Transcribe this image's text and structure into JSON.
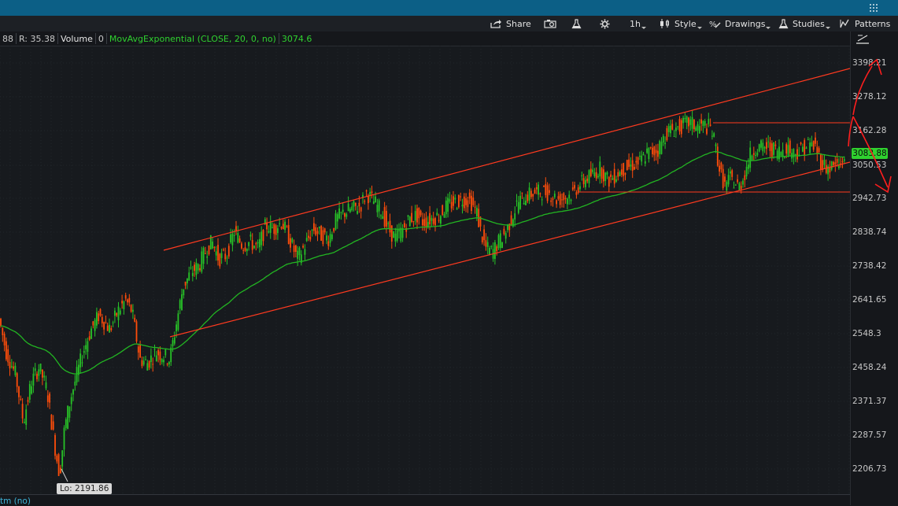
{
  "toolbar": {
    "share_label": "Share",
    "timeframe_label": "1h",
    "style_label": "Style",
    "drawings_label": "Drawings",
    "studies_label": "Studies",
    "patterns_label": "Patterns"
  },
  "study_bar": {
    "truncated_value": "88",
    "r_label": "R: 35.38",
    "volume_label": "Volume",
    "volume_value": "0",
    "ma_label": "MovAvgExponential (CLOSE, 20, 0, no)",
    "ma_value": "3074.6"
  },
  "lower_study_label": "tm (no)",
  "colors": {
    "up_candle": "#27c227",
    "down_candle": "#ff4d0a",
    "ema_line": "#22b522",
    "trendline": "#ff3a1f",
    "annotation": "#ff1e1e",
    "last_price_bg": "#2fd12f"
  },
  "chart_data": {
    "type": "candlestick",
    "instrument_timeframe": "1h",
    "y_ticks": [
      "3398.21",
      "3278.12",
      "3162.28",
      "3050.53",
      "2942.73",
      "2838.74",
      "2738.42",
      "2641.65",
      "2548.3",
      "2458.24",
      "2371.37",
      "2287.57",
      "2206.73"
    ],
    "ylim": [
      2170,
      3470
    ],
    "y_scale": "log",
    "last_price": "3083.88",
    "low_label": "Lo: 2191.86",
    "low_value": 2191.86,
    "ema_period": 20,
    "ema_last_value": 3074.6,
    "price_path": [
      [
        0,
        2600
      ],
      [
        10,
        2500
      ],
      [
        22,
        2440
      ],
      [
        32,
        2320
      ],
      [
        42,
        2420
      ],
      [
        52,
        2460
      ],
      [
        62,
        2400
      ],
      [
        72,
        2260
      ],
      [
        78,
        2192
      ],
      [
        84,
        2300
      ],
      [
        92,
        2380
      ],
      [
        100,
        2440
      ],
      [
        108,
        2500
      ],
      [
        118,
        2560
      ],
      [
        128,
        2600
      ],
      [
        135,
        2580
      ],
      [
        142,
        2560
      ],
      [
        152,
        2610
      ],
      [
        162,
        2640
      ],
      [
        170,
        2610
      ],
      [
        180,
        2480
      ],
      [
        190,
        2470
      ],
      [
        200,
        2500
      ],
      [
        210,
        2490
      ],
      [
        218,
        2480
      ],
      [
        225,
        2560
      ],
      [
        235,
        2680
      ],
      [
        245,
        2720
      ],
      [
        255,
        2740
      ],
      [
        265,
        2790
      ],
      [
        272,
        2810
      ],
      [
        280,
        2760
      ],
      [
        290,
        2770
      ],
      [
        300,
        2840
      ],
      [
        310,
        2800
      ],
      [
        320,
        2810
      ],
      [
        330,
        2790
      ],
      [
        340,
        2860
      ],
      [
        350,
        2850
      ],
      [
        360,
        2870
      ],
      [
        370,
        2820
      ],
      [
        380,
        2760
      ],
      [
        390,
        2800
      ],
      [
        400,
        2850
      ],
      [
        410,
        2830
      ],
      [
        420,
        2820
      ],
      [
        430,
        2880
      ],
      [
        440,
        2900
      ],
      [
        450,
        2910
      ],
      [
        460,
        2920
      ],
      [
        468,
        2960
      ],
      [
        478,
        2930
      ],
      [
        488,
        2900
      ],
      [
        495,
        2850
      ],
      [
        505,
        2820
      ],
      [
        515,
        2850
      ],
      [
        522,
        2880
      ],
      [
        532,
        2890
      ],
      [
        540,
        2870
      ],
      [
        550,
        2880
      ],
      [
        560,
        2890
      ],
      [
        570,
        2920
      ],
      [
        580,
        2930
      ],
      [
        590,
        2940
      ],
      [
        600,
        2935
      ],
      [
        608,
        2900
      ],
      [
        614,
        2830
      ],
      [
        620,
        2790
      ],
      [
        628,
        2780
      ],
      [
        636,
        2810
      ],
      [
        645,
        2840
      ],
      [
        652,
        2880
      ],
      [
        660,
        2930
      ],
      [
        670,
        2950
      ],
      [
        680,
        2960
      ],
      [
        690,
        2965
      ],
      [
        700,
        2960
      ],
      [
        710,
        2940
      ],
      [
        720,
        2945
      ],
      [
        730,
        2960
      ],
      [
        740,
        2990
      ],
      [
        748,
        3010
      ],
      [
        755,
        3020
      ],
      [
        765,
        3040
      ],
      [
        775,
        3000
      ],
      [
        785,
        3020
      ],
      [
        795,
        3040
      ],
      [
        805,
        3050
      ],
      [
        815,
        3060
      ],
      [
        825,
        3090
      ],
      [
        838,
        3100
      ],
      [
        850,
        3160
      ],
      [
        860,
        3170
      ],
      [
        870,
        3180
      ],
      [
        878,
        3190
      ],
      [
        888,
        3175
      ],
      [
        898,
        3180
      ],
      [
        906,
        3170
      ],
      [
        912,
        3100
      ],
      [
        918,
        3020
      ],
      [
        924,
        2980
      ],
      [
        930,
        3010
      ],
      [
        936,
        2990
      ],
      [
        942,
        2980
      ],
      [
        948,
        3020
      ],
      [
        955,
        3080
      ],
      [
        962,
        3110
      ],
      [
        970,
        3105
      ],
      [
        978,
        3110
      ],
      [
        986,
        3100
      ],
      [
        994,
        3095
      ],
      [
        1002,
        3110
      ],
      [
        1010,
        3090
      ],
      [
        1020,
        3100
      ],
      [
        1030,
        3120
      ],
      [
        1038,
        3110
      ],
      [
        1046,
        3060
      ],
      [
        1054,
        3040
      ],
      [
        1062,
        3050
      ],
      [
        1070,
        3050
      ],
      [
        1075,
        3084
      ]
    ]
  }
}
